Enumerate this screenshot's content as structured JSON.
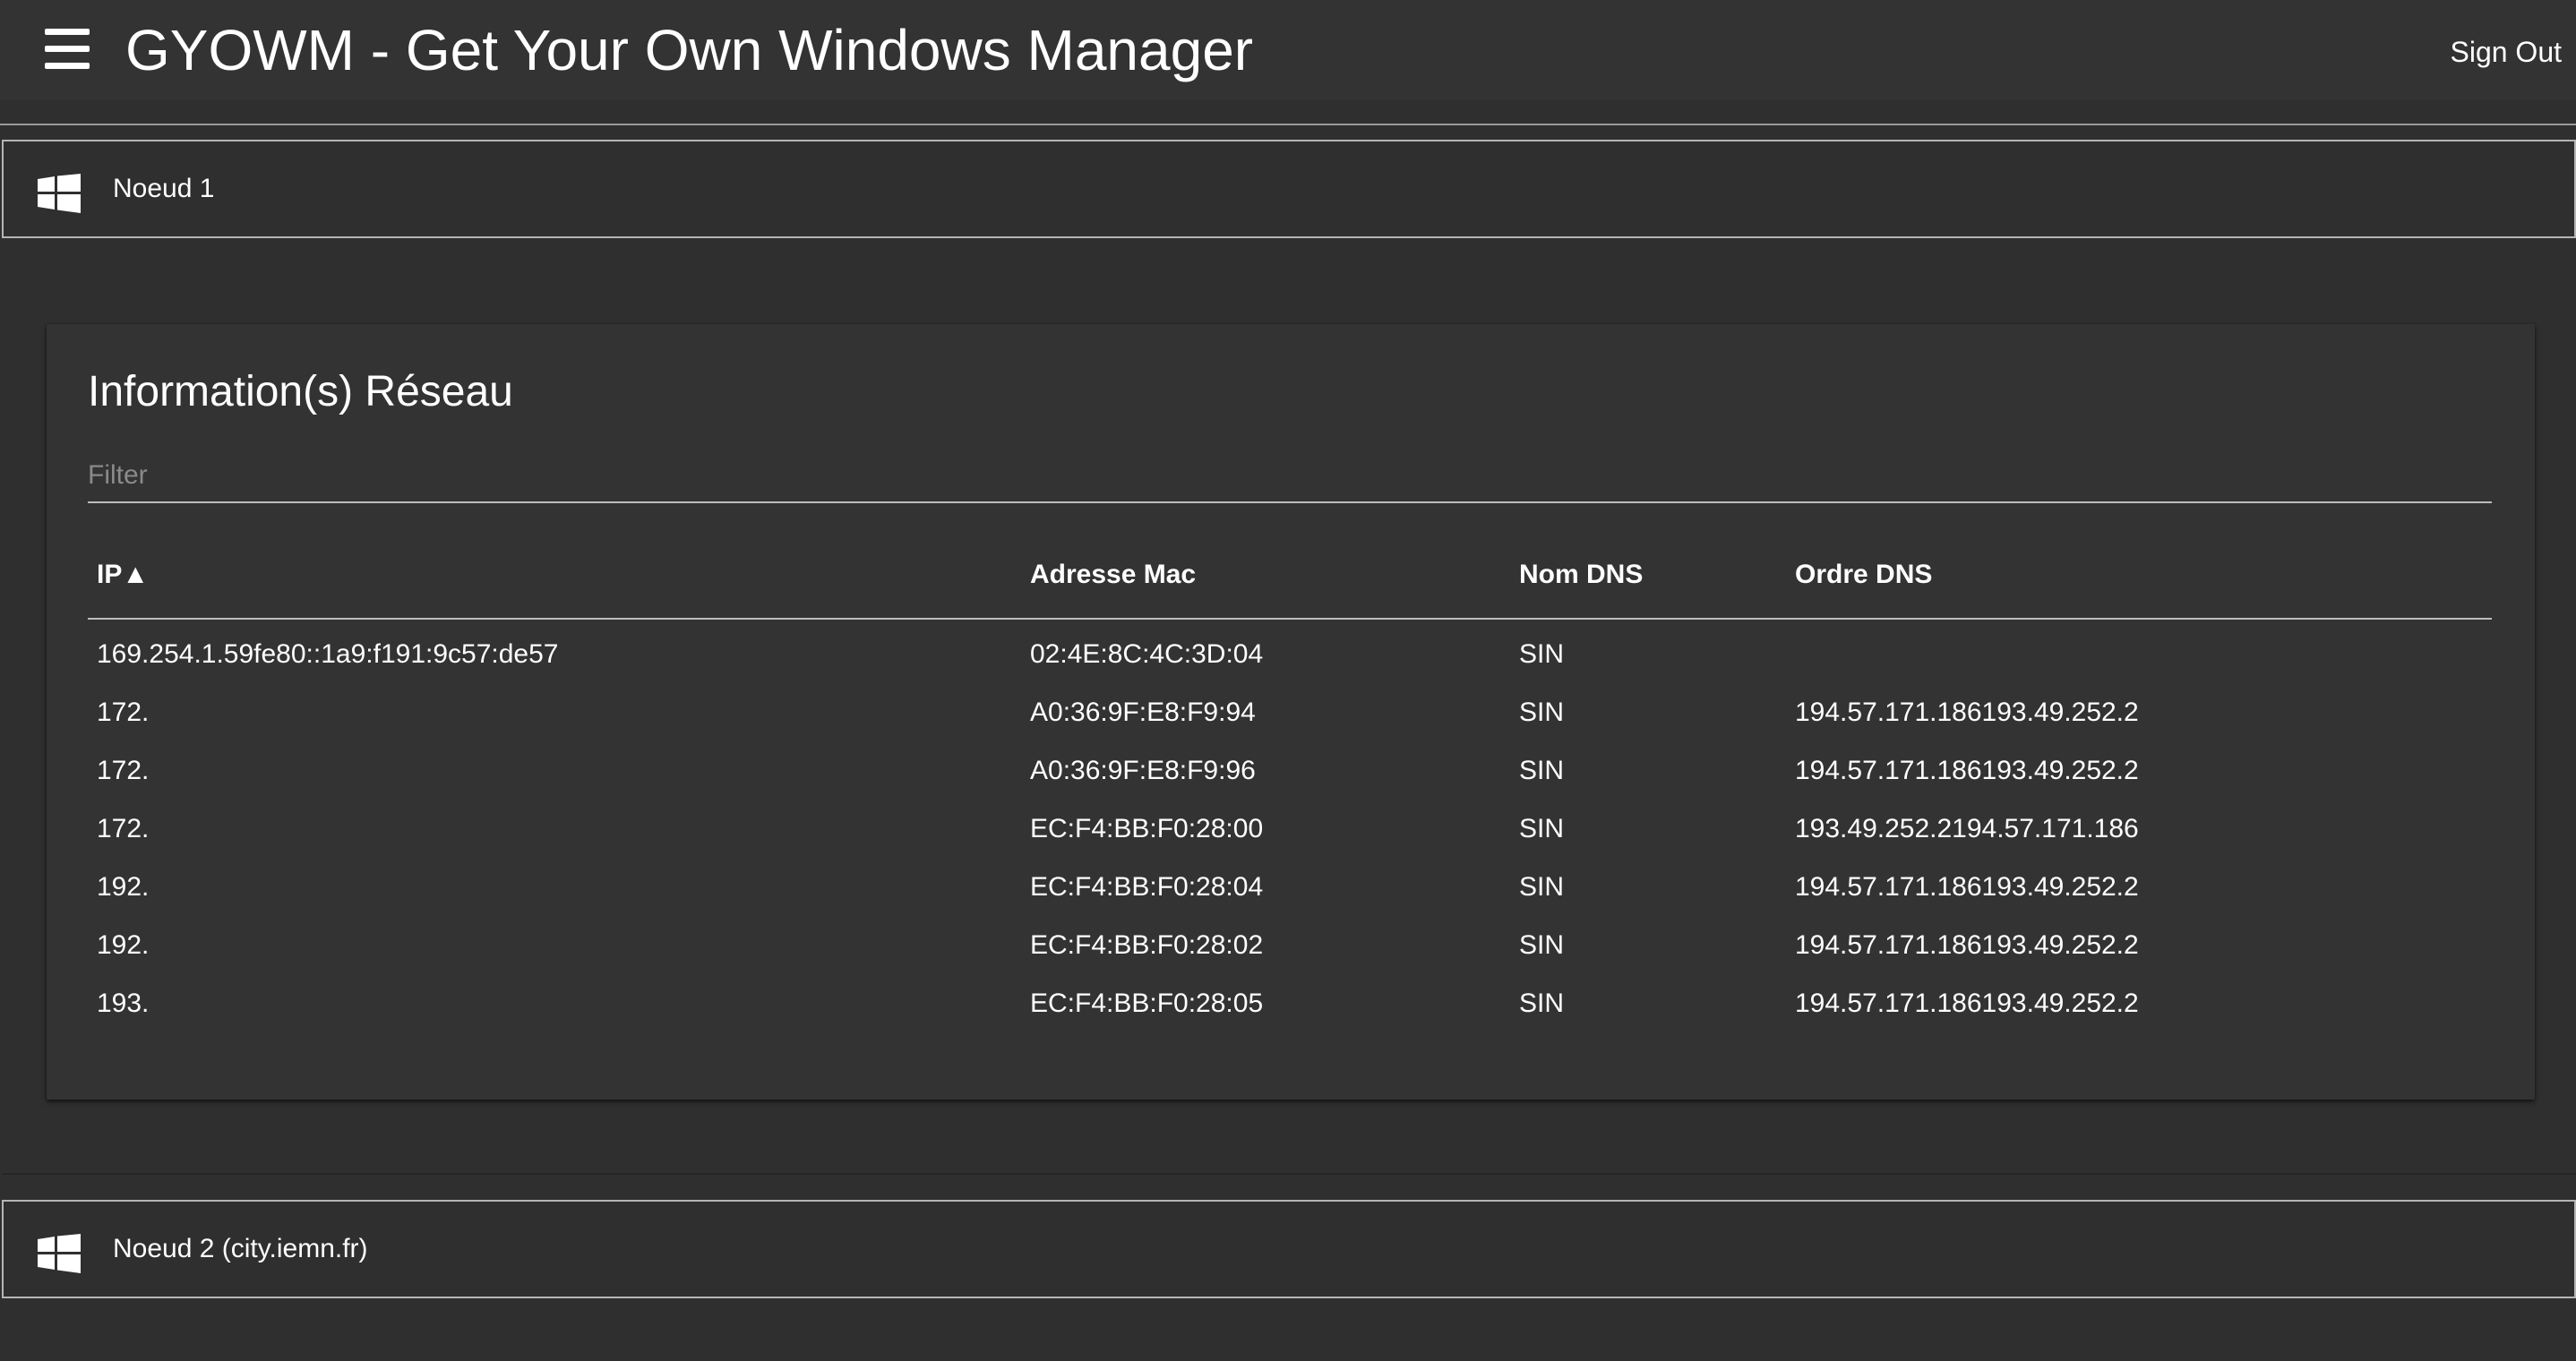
{
  "app": {
    "title": "GYOWM - Get Your Own Windows Manager",
    "sign_out_label": "Sign Out",
    "menu_icon": "hamburger-menu-icon"
  },
  "nodes": [
    {
      "label": "Noeud 1",
      "icon": "windows-logo-icon",
      "expanded": true
    },
    {
      "label": "Noeud 2 (city.iemn.fr)",
      "icon": "windows-logo-icon",
      "expanded": false
    }
  ],
  "network": {
    "title": "Information(s) Réseau",
    "filter": {
      "placeholder": "Filter",
      "value": ""
    },
    "columns": [
      "IP▲",
      "Adresse Mac",
      "Nom DNS",
      "Ordre DNS"
    ],
    "sort": {
      "column": "IP",
      "direction": "ascending"
    },
    "rows": [
      {
        "ip": "169.254.1.59fe80::1a9:f191:9c57:de57",
        "mac": "02:4E:8C:4C:3D:04",
        "dns_name": "SIN",
        "dns_order": ""
      },
      {
        "ip": "172.",
        "mac": "A0:36:9F:E8:F9:94",
        "dns_name": "SIN",
        "dns_order": "194.57.171.186193.49.252.2"
      },
      {
        "ip": "172.",
        "mac": "A0:36:9F:E8:F9:96",
        "dns_name": "SIN",
        "dns_order": "194.57.171.186193.49.252.2"
      },
      {
        "ip": "172.",
        "mac": "EC:F4:BB:F0:28:00",
        "dns_name": "SIN",
        "dns_order": "193.49.252.2194.57.171.186"
      },
      {
        "ip": "192.",
        "mac": "EC:F4:BB:F0:28:04",
        "dns_name": "SIN",
        "dns_order": "194.57.171.186193.49.252.2"
      },
      {
        "ip": "192.",
        "mac": "EC:F4:BB:F0:28:02",
        "dns_name": "SIN",
        "dns_order": "194.57.171.186193.49.252.2"
      },
      {
        "ip": "193.",
        "mac": "EC:F4:BB:F0:28:05",
        "dns_name": "SIN",
        "dns_order": "194.57.171.186193.49.252.2"
      }
    ]
  },
  "colors": {
    "background": "#2f2f2f",
    "appbar": "#333333",
    "card": "#333333",
    "text": "#ffffff",
    "placeholder": "#8a8a8a",
    "divider": "#bdbdbd"
  }
}
